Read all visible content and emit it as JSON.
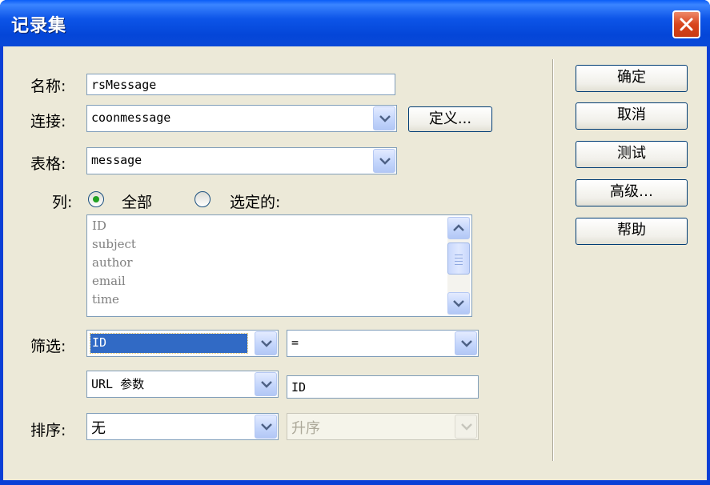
{
  "window": {
    "title": "记录集"
  },
  "form": {
    "name_label": "名称:",
    "name_value": "rsMessage",
    "connection_label": "连接:",
    "connection_value": "coonmessage",
    "define_button": "定义...",
    "table_label": "表格:",
    "table_value": "message",
    "columns_label": "列:",
    "columns_all": "全部",
    "columns_selected": "选定的:",
    "columns_selected_option": "all",
    "columns_list": [
      "ID",
      "subject",
      "author",
      "email",
      "time"
    ],
    "filter_label": "筛选:",
    "filter_column": "ID",
    "filter_operator": "=",
    "filter_source": "URL 参数",
    "filter_value": "ID",
    "sort_label": "排序:",
    "sort_column": "无",
    "sort_order": "升序"
  },
  "buttons": {
    "ok": "确定",
    "cancel": "取消",
    "test": "测试",
    "advanced": "高级…",
    "help": "帮助"
  },
  "colors": {
    "titlebar": "#0a5df7",
    "dialog_bg": "#ece9d8",
    "selection": "#316ac5"
  }
}
